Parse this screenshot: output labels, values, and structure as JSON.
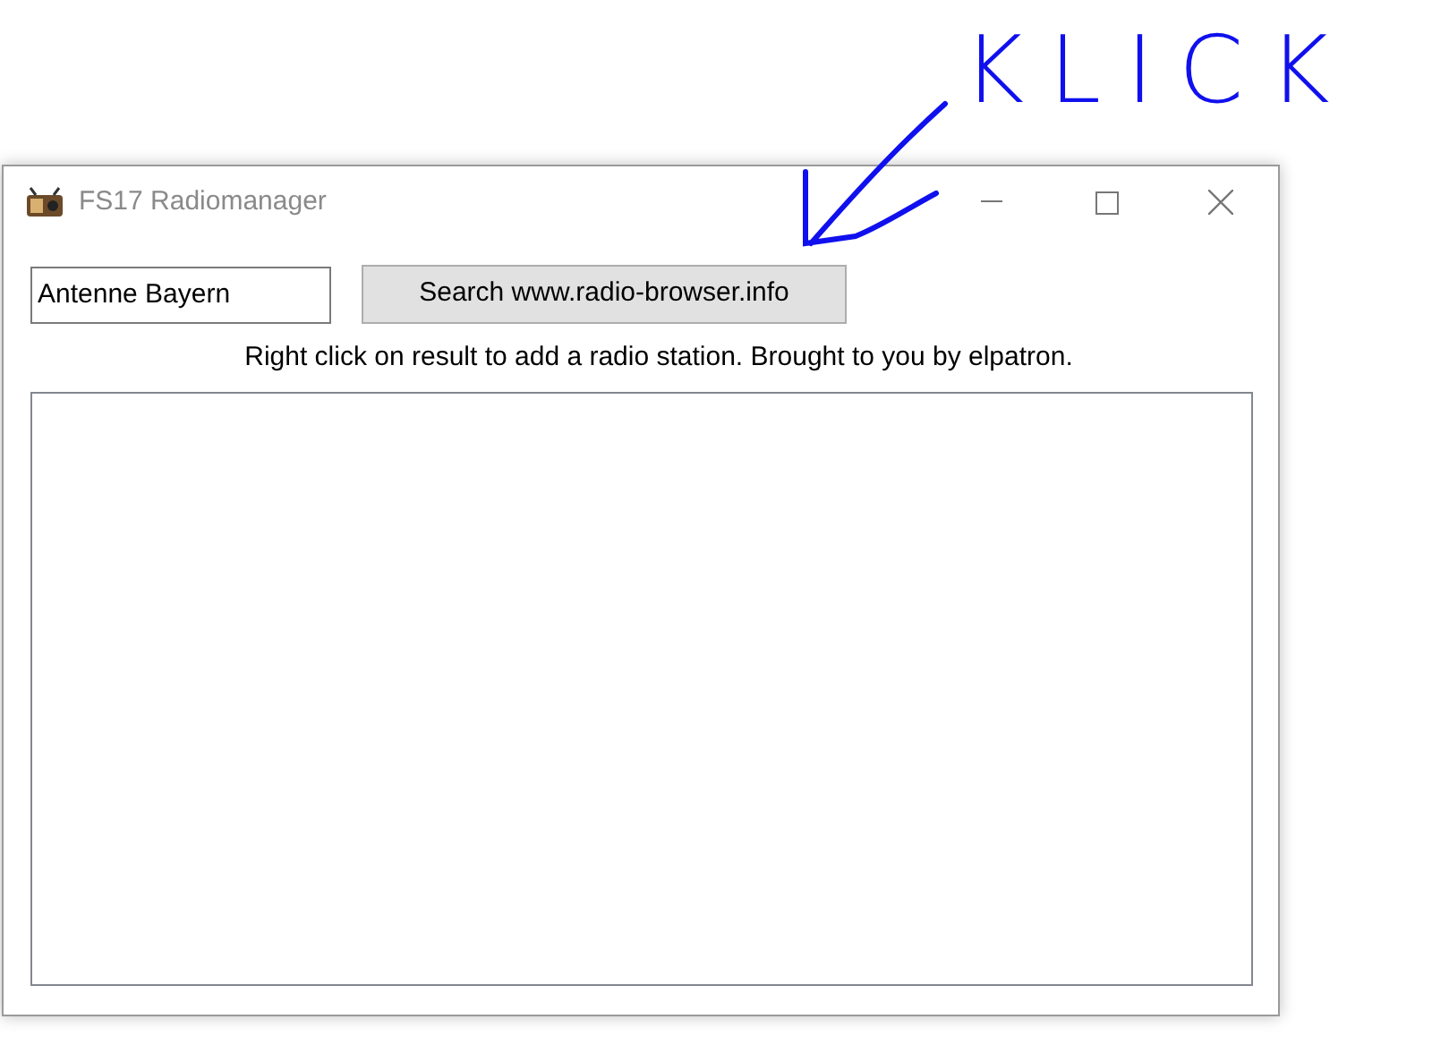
{
  "window": {
    "title": "FS17 Radiomanager"
  },
  "search": {
    "value": "Antenne Bayern"
  },
  "search_button": {
    "label": "Search www.radio-browser.info"
  },
  "hint": "Right click on result to add a radio station. Brought to you by elpatron.",
  "annotation": {
    "text": "KLICK"
  }
}
